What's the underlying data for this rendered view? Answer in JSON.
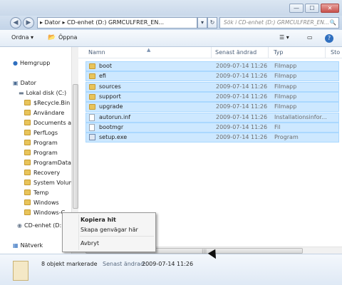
{
  "window": {
    "minimize": "—",
    "maximize": "☐",
    "close": "✕",
    "close_color": "#c7504b"
  },
  "address": {
    "back_icon": "◀",
    "forward_icon": "▶",
    "path": "▸ Dator ▸ CD-enhet (D:) GRMCULFRER_EN...",
    "dropdown_icon": "▾",
    "refresh_icon": "↻",
    "search_placeholder": "Sök i CD-enhet (D:) GRMCULFRER_EN...",
    "search_icon": "🔍"
  },
  "toolbar": {
    "organize": "Ordna ▾",
    "open": "Öppna",
    "view_icon": "☰ ▾",
    "preview_icon": "▭",
    "help_icon": "?"
  },
  "nav": {
    "homegroup": "Hemgrupp",
    "computer": "Dator",
    "local_disk": "Lokal disk (C:)",
    "folders": [
      "$Recycle.Bin",
      "Användare",
      "Documents and",
      "PerfLogs",
      "Program",
      "Program",
      "ProgramData",
      "Recovery",
      "System Volume",
      "Temp",
      "Windows",
      "Windows-C"
    ],
    "cd_drive": "CD-enhet (D:)",
    "network": "Nätverk"
  },
  "columns": {
    "name": "Namn",
    "date": "Senast ändrad",
    "type": "Typ",
    "size": "Sto"
  },
  "files": [
    {
      "name": "boot",
      "date": "2009-07-14 11:26",
      "type": "Filmapp",
      "icon": "folder-icon"
    },
    {
      "name": "efi",
      "date": "2009-07-14 11:26",
      "type": "Filmapp",
      "icon": "folder-icon"
    },
    {
      "name": "sources",
      "date": "2009-07-14 11:26",
      "type": "Filmapp",
      "icon": "folder-icon"
    },
    {
      "name": "support",
      "date": "2009-07-14 11:26",
      "type": "Filmapp",
      "icon": "folder-icon"
    },
    {
      "name": "upgrade",
      "date": "2009-07-14 11:26",
      "type": "Filmapp",
      "icon": "folder-icon"
    },
    {
      "name": "autorun.inf",
      "date": "2009-07-14 11:26",
      "type": "Installationsinfor...",
      "icon": "file-icon"
    },
    {
      "name": "bootmgr",
      "date": "2009-07-14 11:26",
      "type": "Fil",
      "icon": "file-icon"
    },
    {
      "name": "setup.exe",
      "date": "2009-07-14 11:26",
      "type": "Program",
      "icon": "exe-icon"
    }
  ],
  "context_menu": {
    "copy_here": "Kopiera hit",
    "create_shortcut": "Skapa genvägar här",
    "cancel": "Avbryt"
  },
  "details": {
    "selected": "8 objekt markerade",
    "modified_label": "Senast ändrad:",
    "modified_value": "2009-07-14 11:26"
  },
  "colors": {
    "selection_bg": "#cde8ff",
    "selection_border": "#aad8ff",
    "folder": "#e8c45b"
  }
}
